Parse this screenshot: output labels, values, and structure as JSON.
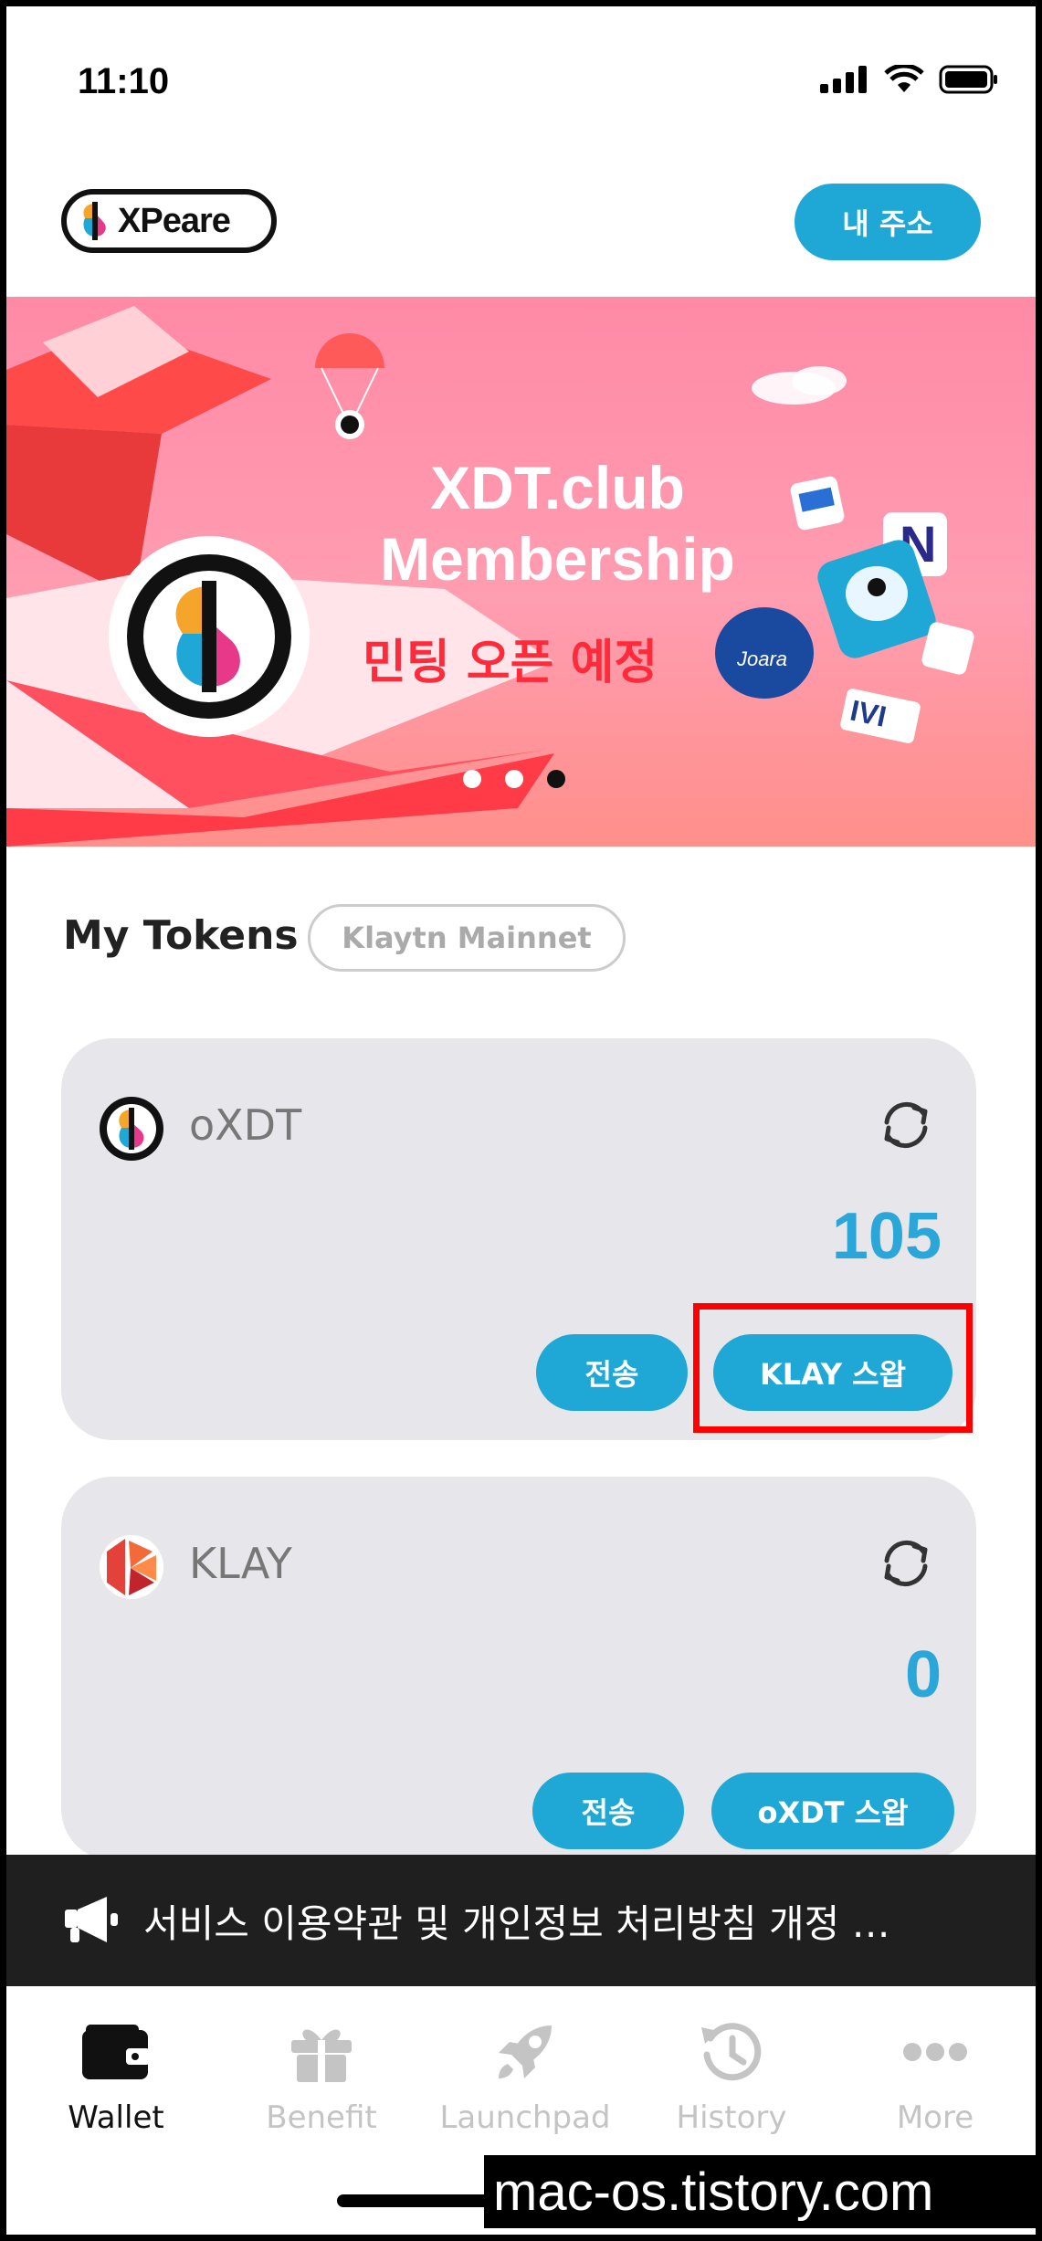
{
  "status_bar": {
    "time": "11:10"
  },
  "header": {
    "logo_text": "XPeare",
    "address_button": "내 주소"
  },
  "banner": {
    "title_line1": "XDT.club",
    "title_line2": "Membership",
    "subtitle": "민팅 오픈 예정",
    "dots": 3,
    "active_dot": 3
  },
  "section": {
    "title": "My Tokens",
    "network": "Klaytn Mainnet"
  },
  "tokens": [
    {
      "name": "oXDT",
      "balance": "105",
      "send_label": "전송",
      "swap_label": "KLAY 스왑"
    },
    {
      "name": "KLAY",
      "balance": "0",
      "send_label": "전송",
      "swap_label": "oXDT 스왑"
    }
  ],
  "notice": {
    "text": "서비스 이용약관 및 개인정보 처리방침 개정 …"
  },
  "tabs": [
    {
      "label": "Wallet",
      "icon": "wallet-icon",
      "active": true
    },
    {
      "label": "Benefit",
      "icon": "gift-icon",
      "active": false
    },
    {
      "label": "Launchpad",
      "icon": "rocket-icon",
      "active": false
    },
    {
      "label": "History",
      "icon": "history-icon",
      "active": false
    },
    {
      "label": "More",
      "icon": "more-icon",
      "active": false
    }
  ],
  "watermark": "mac-os.tistory.com",
  "colors": {
    "accent": "#1fa8d6",
    "balance": "#2aa6d8",
    "highlight": "#ff0000",
    "banner_pink": "#ff8aa6"
  }
}
